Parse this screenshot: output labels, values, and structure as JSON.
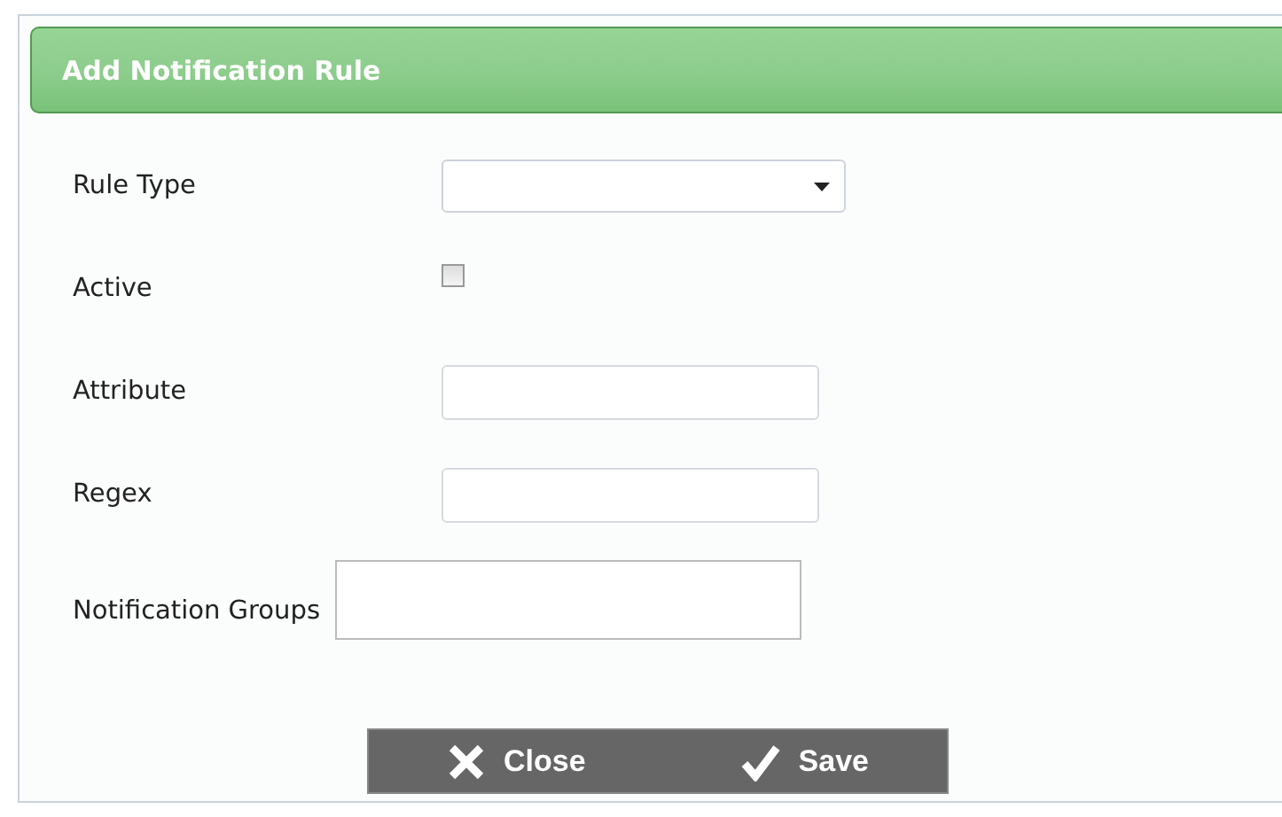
{
  "dialog": {
    "title": "Add Notification Rule"
  },
  "fields": [
    {
      "kind": "select",
      "label": "Rule Type"
    },
    {
      "kind": "checkbox",
      "label": "Active",
      "checked": false
    },
    {
      "kind": "text",
      "label": "Attribute"
    },
    {
      "kind": "text",
      "label": "Regex"
    },
    {
      "kind": "textarea",
      "label": "Notification Groups"
    }
  ],
  "buttons": [
    {
      "kind": "close",
      "label": "Close"
    },
    {
      "kind": "save",
      "label": "Save"
    }
  ]
}
